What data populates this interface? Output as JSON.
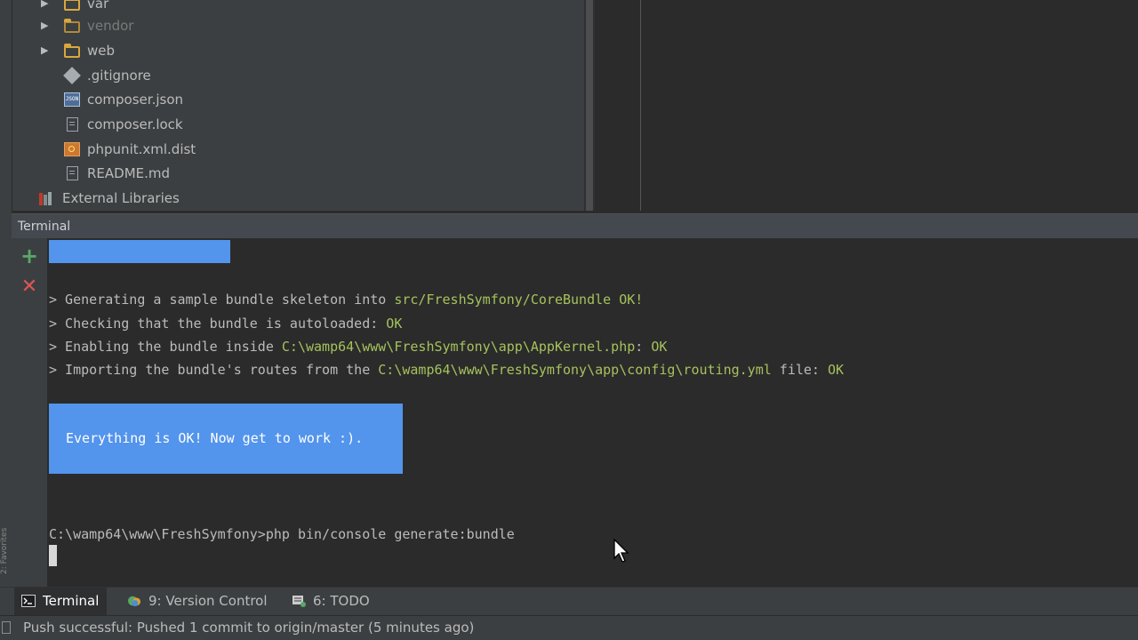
{
  "project_tree": {
    "items": [
      {
        "label": "var",
        "type": "folder",
        "muted": false
      },
      {
        "label": "vendor",
        "type": "folder",
        "muted": true
      },
      {
        "label": "web",
        "type": "folder",
        "muted": false
      },
      {
        "label": ".gitignore",
        "type": "git-file"
      },
      {
        "label": "composer.json",
        "type": "json-file"
      },
      {
        "label": "composer.lock",
        "type": "file"
      },
      {
        "label": "phpunit.xml.dist",
        "type": "xml-file"
      },
      {
        "label": "README.md",
        "type": "file"
      },
      {
        "label": "External Libraries",
        "type": "libraries"
      }
    ]
  },
  "terminal": {
    "title": "Terminal",
    "toolbar": {
      "new_session_icon": "plus-icon",
      "close_session_icon": "close-icon"
    },
    "lines": [
      {
        "prefix": "> Generating a sample bundle skeleton into ",
        "path": "src/FreshSymfony/CoreBundle",
        "suffix": " ",
        "status": "OK!"
      },
      {
        "prefix": "> Checking that the bundle is autoloaded: ",
        "path": "",
        "suffix": "",
        "status": "OK"
      },
      {
        "prefix": "> Enabling the bundle inside ",
        "path": "C:\\wamp64\\www\\FreshSymfony\\app\\AppKernel.php",
        "suffix": ": ",
        "status": "OK"
      },
      {
        "prefix": "> Importing the bundle's routes from the ",
        "path": "C:\\wamp64\\www\\FreshSymfony\\app\\config\\routing.yml",
        "suffix": " file: ",
        "status": "OK"
      }
    ],
    "success_message": "Everything is OK! Now get to work :).",
    "prompt": "C:\\wamp64\\www\\FreshSymfony>php bin/console generate:bundle",
    "accent_color": "#5394ec",
    "path_color": "#a5c25c"
  },
  "tool_tabs": [
    {
      "label": "Terminal",
      "icon": "terminal-icon",
      "active": true
    },
    {
      "label": "9: Version Control",
      "icon": "version-control-icon",
      "active": false
    },
    {
      "label": "6: TODO",
      "icon": "todo-icon",
      "active": false
    }
  ],
  "status_bar": {
    "message": "Push successful: Pushed 1 commit to origin/master (5 minutes ago)"
  },
  "favorites_label": "2: Favorites"
}
